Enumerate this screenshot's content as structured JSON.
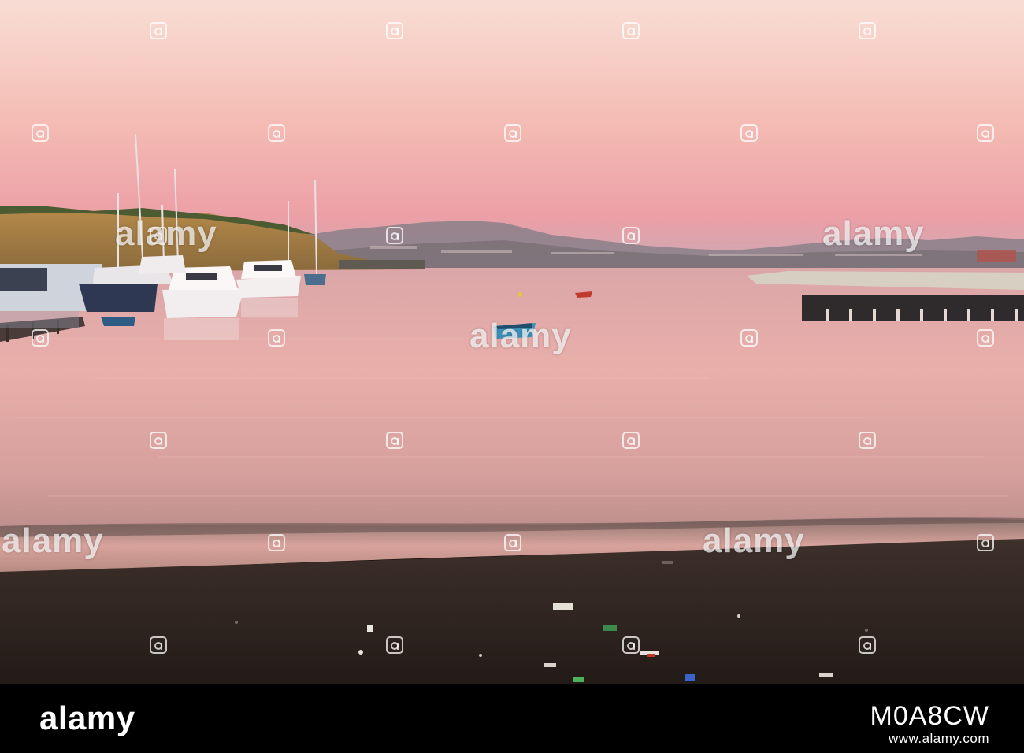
{
  "watermark": {
    "small_mark": "alamy",
    "big_mark": "alamy"
  },
  "footer": {
    "brand": "alamy",
    "image_id": "M0A8CW",
    "site": "www.alamy.com"
  },
  "colors": {
    "sky_top": "#f7d6ce",
    "sky_mid": "#f3b4b0",
    "sky_horizon": "#e7a6a6",
    "sea": "#e3aaa8",
    "sand": "#2a211d",
    "footer": "#000000"
  }
}
